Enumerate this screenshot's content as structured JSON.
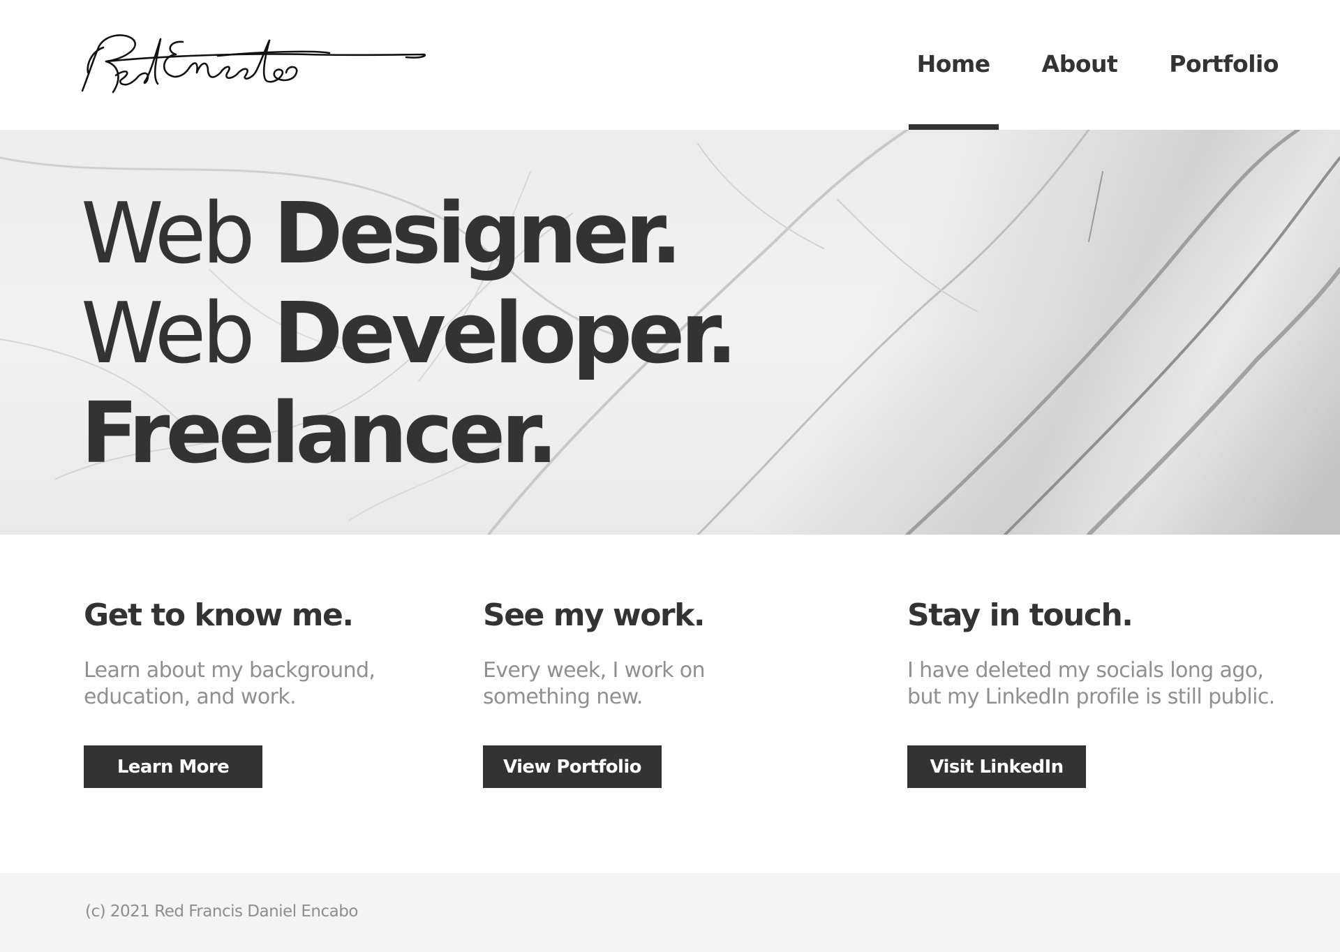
{
  "header": {
    "logo_text": "Red Encabo",
    "nav": [
      {
        "label": "Home",
        "active": true
      },
      {
        "label": "About",
        "active": false
      },
      {
        "label": "Portfolio",
        "active": false
      }
    ]
  },
  "hero": {
    "line1": {
      "light": "Web ",
      "bold": "Designer."
    },
    "line2": {
      "light": "Web ",
      "bold": "Developer."
    },
    "line3": {
      "light": "",
      "bold": "Freelancer."
    }
  },
  "cards": [
    {
      "title": "Get to know me.",
      "text": "Learn about my background, education, and work.",
      "button": "Learn More"
    },
    {
      "title": "See my work.",
      "text": "Every week, I work on something new.",
      "button": "View Portfolio"
    },
    {
      "title": "Stay in touch.",
      "text": "I have deleted my socials long ago, but my LinkedIn profile is still public.",
      "button": "Visit LinkedIn"
    }
  ],
  "footer": {
    "copyright": "(c) 2021 Red Francis Daniel Encabo"
  },
  "colors": {
    "text_dark": "#333333",
    "text_muted": "#8f8f8f",
    "footer_bg": "#f4f4f4"
  }
}
